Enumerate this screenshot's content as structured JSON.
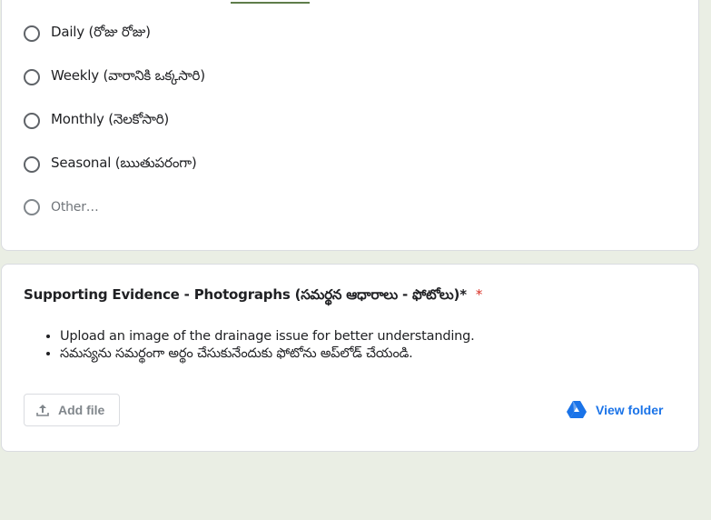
{
  "options": [
    {
      "label": "Daily (రోజు రోజు)"
    },
    {
      "label": "Weekly (వారానికి ఒక్కసారి)"
    },
    {
      "label": "Monthly (నెలకోసారి)"
    },
    {
      "label": "Seasonal (ఋతుపరంగా)"
    },
    {
      "label": "Other…"
    }
  ],
  "question": {
    "title": "Supporting Evidence - Photographs (సమర్థన ఆధారాలు - ఫోటోలు)*",
    "required_mark": "*",
    "bullets": [
      "Upload an image of the drainage issue for better understanding.",
      "సమస్యను సమర్థంగా అర్థం చేసుకునేందుకు ఫోటోను అప్‌లోడ్ చేయండి."
    ],
    "add_file_label": "Add file",
    "view_folder_label": "View folder"
  },
  "colors": {
    "background": "#eaeee4",
    "accent": "#5f7d4a",
    "required": "#d93025",
    "link": "#1a73e8"
  }
}
